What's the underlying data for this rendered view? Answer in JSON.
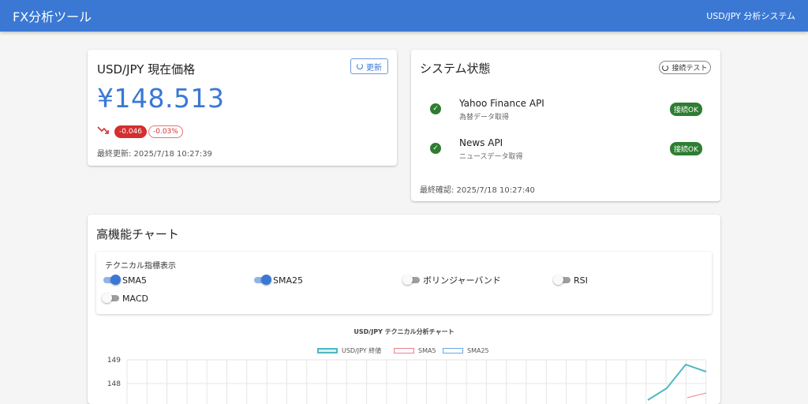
{
  "app": {
    "title": "FX分析ツール",
    "subtitle": "USD/JPY 分析システム"
  },
  "price_card": {
    "title": "USD/JPY 現在価格",
    "refresh_label": "更新",
    "price": "¥148.513",
    "change": "-0.046",
    "change_percent": "-0.03%",
    "last_updated": "最終更新: 2025/7/18 10:27:39",
    "trend_icon": "trending-down-icon",
    "accent_color": "#3a78d4",
    "negative_color": "#d32f2f"
  },
  "system_card": {
    "title": "システム状態",
    "test_label": "接続テスト",
    "services": [
      {
        "name": "Yahoo Finance API",
        "desc": "為替データ取得",
        "status": "接続OK"
      },
      {
        "name": "News API",
        "desc": "ニュースデータ取得",
        "status": "接続OK"
      }
    ],
    "last_checked": "最終確認: 2025/7/18 10:27:40",
    "ok_color": "#2e7d32"
  },
  "chart_card": {
    "title": "高機能チャート",
    "indicators_label": "テクニカル指標表示",
    "indicators": [
      {
        "label": "SMA5",
        "enabled": true
      },
      {
        "label": "SMA25",
        "enabled": true
      },
      {
        "label": "ボリンジャーバンド",
        "enabled": false
      },
      {
        "label": "RSI",
        "enabled": false
      },
      {
        "label": "MACD",
        "enabled": false
      }
    ]
  },
  "chart_data": {
    "type": "line",
    "title": "USD/JPY テクニカル分析チャート",
    "legend": [
      "USD/JPY 終値",
      "SMA5",
      "SMA25"
    ],
    "series_colors": [
      "#4fb8c4",
      "#ef7d8e",
      "#6aa8e0"
    ],
    "y_ticks": [
      149,
      148
    ],
    "visible_series": [
      {
        "name": "USD/JPY 終値",
        "values": [
          147.3,
          147.8,
          148.8,
          148.5
        ]
      },
      {
        "name": "SMA5",
        "values": [
          147.4,
          147.6
        ]
      }
    ]
  }
}
